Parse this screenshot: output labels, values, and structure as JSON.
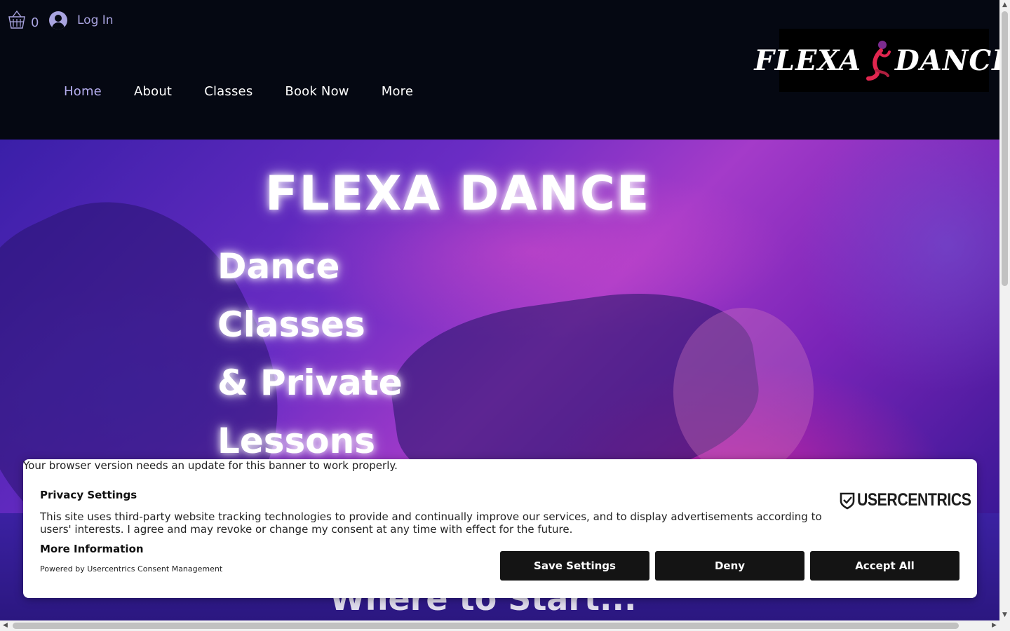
{
  "header": {
    "cart_count": "0",
    "login_label": "Log In",
    "nav": [
      {
        "label": "Home",
        "active": true
      },
      {
        "label": "About"
      },
      {
        "label": "Classes"
      },
      {
        "label": "Book Now"
      },
      {
        "label": "More"
      }
    ],
    "logo": {
      "left": "FLEXA",
      "right": "DANCE"
    }
  },
  "hero": {
    "title": "FLEXA DANCE",
    "subtitle_lines": [
      "Dance",
      "Classes",
      "& Private",
      "Lessons"
    ]
  },
  "strip": {
    "partial_heading": "Where to Start..."
  },
  "consent": {
    "warning": "Your browser version needs an update for this banner to work properly.",
    "title": "Privacy Settings",
    "text": "This site uses third-party website tracking technologies to provide and continually improve our services, and to display advertisements according to users' interests. I agree and may revoke or change my consent at any time with effect for the future.",
    "more_info": "More Information",
    "powered_by": "Powered by Usercentrics Consent Management",
    "brand": "USERCENTRICS",
    "buttons": {
      "save": "Save Settings",
      "deny": "Deny",
      "accept": "Accept All"
    }
  },
  "colors": {
    "header_bg": "#050812",
    "nav_active": "#b5aeef",
    "button_bg": "#141414",
    "hero_purple": "#6a2cc4",
    "hero_magenta": "#ff2896"
  }
}
